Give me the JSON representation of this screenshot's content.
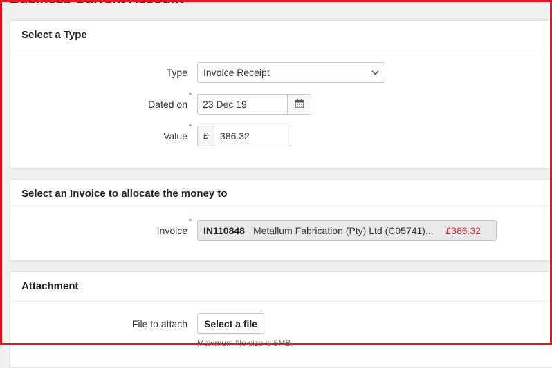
{
  "page": {
    "title": "Business Current Account"
  },
  "type_panel": {
    "heading": "Select a Type",
    "type": {
      "label": "Type",
      "value": "Invoice Receipt"
    },
    "dated_on": {
      "label": "Dated on",
      "required_mark": "*",
      "value": "23 Dec 19"
    },
    "value": {
      "label": "Value",
      "required_mark": "*",
      "currency": "£",
      "amount": "386.32"
    }
  },
  "invoice_panel": {
    "heading": "Select an Invoice to allocate the money to",
    "invoice": {
      "label": "Invoice",
      "required_mark": "*",
      "number": "IN110848",
      "description": "Metallum Fabrication (Pty) Ltd (C05741)...",
      "amount": "£386.32"
    }
  },
  "attachment_panel": {
    "heading": "Attachment",
    "file": {
      "label": "File to attach",
      "button": "Select a file",
      "hint": "Maximum file size is 5MB."
    }
  },
  "colors": {
    "required": "#e0272f",
    "highlight_border": "#e8141e",
    "amount": "#e0272f"
  },
  "icons": {
    "type_dropdown": "chevron-down-icon",
    "date_picker": "calendar-icon"
  }
}
